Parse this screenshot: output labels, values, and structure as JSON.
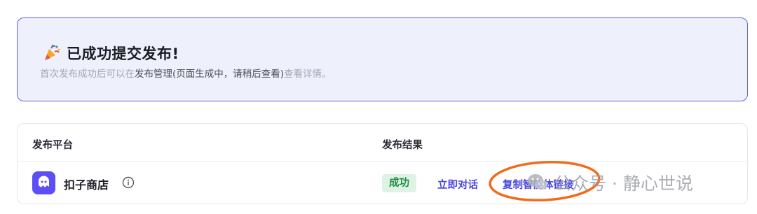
{
  "banner": {
    "title": "已成功提交发布!",
    "desc_prefix": "首次发布成功后可以在",
    "desc_dark": "发布管理(页面生成中，请稍后查看)",
    "desc_suffix": "查看详情。",
    "icon": "party-popper-icon"
  },
  "table": {
    "headers": [
      "发布平台",
      "发布结果"
    ],
    "rows": [
      {
        "platform": "扣子商店",
        "platform_icon": "coze-logo-icon",
        "status": "成功",
        "actions": [
          "立即对话",
          "复制智能体链接"
        ]
      }
    ]
  },
  "colors": {
    "accent": "#5b61e8",
    "link": "#4b47de",
    "success_bg": "#dff3e5",
    "success_text": "#1f8a44",
    "annotation": "#f26b1d"
  },
  "watermark": {
    "text": "公众号 · 静心世说",
    "icon": "wechat-icon"
  }
}
